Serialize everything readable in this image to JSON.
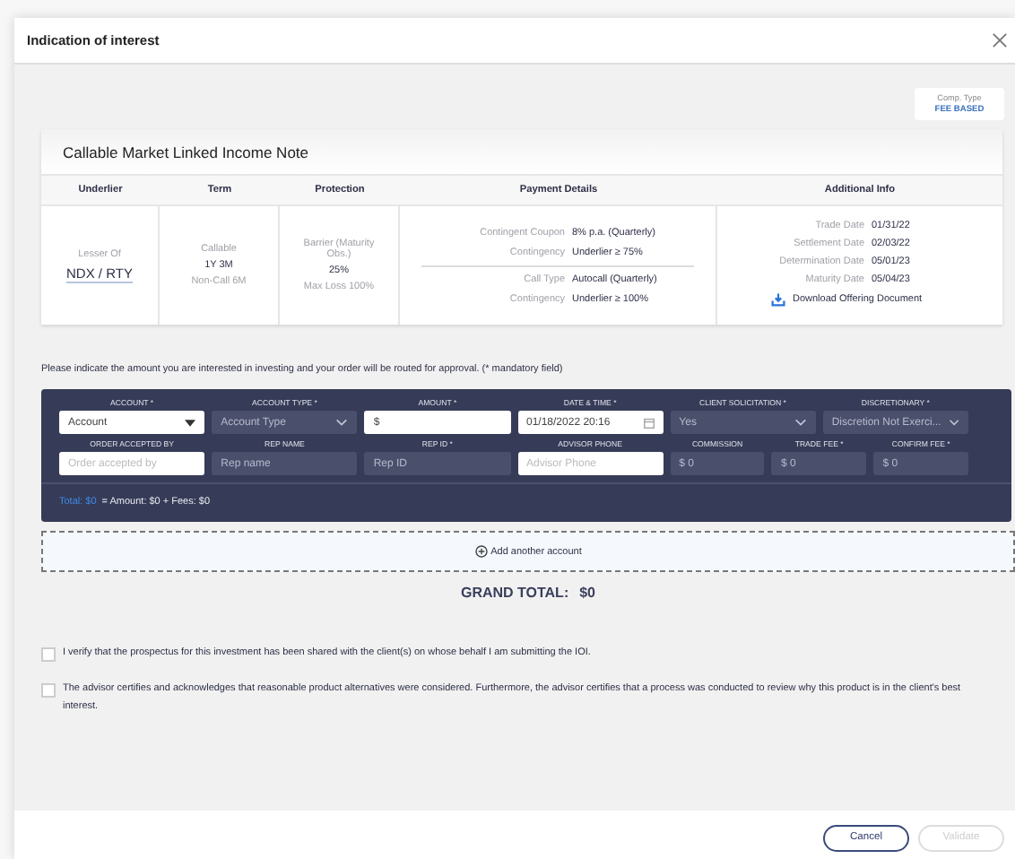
{
  "dialog": {
    "title": "Indication of interest"
  },
  "comp_type": {
    "label": "Comp. Type",
    "value": "FEE BASED"
  },
  "product": {
    "title": "Callable Market Linked Income Note",
    "columns": [
      "Underlier",
      "Term",
      "Protection",
      "Payment Details",
      "Additional Info"
    ],
    "underlier": {
      "caption": "Lesser Of",
      "value": "NDX / RTY"
    },
    "term": {
      "type": "Callable",
      "length": "1Y 3M",
      "note": "Non-Call 6M"
    },
    "protection": {
      "type": "Barrier (Maturity Obs.)",
      "barrier": "25%",
      "note": "Max Loss 100%"
    },
    "payment_groups": [
      [
        {
          "label": "Contingent Coupon",
          "value": "8% p.a. (Quarterly)"
        },
        {
          "label": "Contingency",
          "value": "Underlier ≥ 75%"
        }
      ],
      [
        {
          "label": "Call Type",
          "value": "Autocall (Quarterly)"
        },
        {
          "label": "Contingency",
          "value": "Underlier ≥ 100%"
        }
      ]
    ],
    "additional": [
      {
        "label": "Trade Date",
        "value": "01/31/22"
      },
      {
        "label": "Settlement Date",
        "value": "02/03/22"
      },
      {
        "label": "Determination Date",
        "value": "05/01/23"
      },
      {
        "label": "Maturity Date",
        "value": "05/04/23"
      }
    ],
    "download": "Download Offering Document"
  },
  "instruction": "Please indicate the amount you are interested in investing and your order will be routed for approval. (* mandatory field)",
  "order_form": {
    "rows": [
      [
        {
          "label": "ACCOUNT *",
          "kind": "select",
          "value": "Account",
          "disabled": false
        },
        {
          "label": "ACCOUNT TYPE *",
          "kind": "select",
          "value": "Account Type",
          "disabled": true
        },
        {
          "label": "AMOUNT *",
          "kind": "text",
          "value": "$",
          "disabled": false
        },
        {
          "label": "DATE & TIME *",
          "kind": "date",
          "value": "01/18/2022  20:16",
          "disabled": false
        },
        {
          "label": "CLIENT SOLICITATION *",
          "kind": "select",
          "value": "Yes",
          "disabled": true
        },
        {
          "label": "DISCRETIONARY *",
          "kind": "select",
          "value": "Discretion Not Exerci...",
          "disabled": true
        }
      ],
      [
        {
          "label": "ORDER ACCEPTED BY",
          "kind": "text",
          "placeholder": "Order accepted by",
          "disabled": false
        },
        {
          "label": "REP NAME",
          "kind": "text",
          "value": "Rep name",
          "disabled": true
        },
        {
          "label": "REP ID *",
          "kind": "text",
          "value": "Rep ID",
          "disabled": true
        },
        {
          "label": "ADVISOR PHONE",
          "kind": "text",
          "placeholder": "Advisor Phone",
          "disabled": false
        },
        {
          "label": "COMMISSION",
          "kind": "text",
          "value": "$ 0",
          "disabled": true
        },
        {
          "label": "TRADE FEE *",
          "kind": "text",
          "value": "$ 0",
          "disabled": true
        },
        {
          "label": "CONFIRM FEE *",
          "kind": "text",
          "value": "$ 0",
          "disabled": true
        }
      ]
    ],
    "total": {
      "label": "Total: $0",
      "breakdown": "= Amount: $0 + Fees: $0"
    }
  },
  "add_account": "Add another account",
  "grand_total": {
    "label": "GRAND TOTAL:",
    "value": "$0"
  },
  "confirmations": [
    {
      "text": "I verify that the prospectus for this investment has been shared with the client(s) on whose behalf I am submitting the IOI.",
      "checked": false
    },
    {
      "text": "The advisor certifies and acknowledges that reasonable product alternatives were considered. Furthermore, the advisor certifies that a process was conducted to review why this product is in the client's best interest.",
      "checked": false
    }
  ],
  "buttons": [
    {
      "label": "Cancel",
      "disabled": false
    },
    {
      "label": "Validate",
      "disabled": true
    }
  ]
}
